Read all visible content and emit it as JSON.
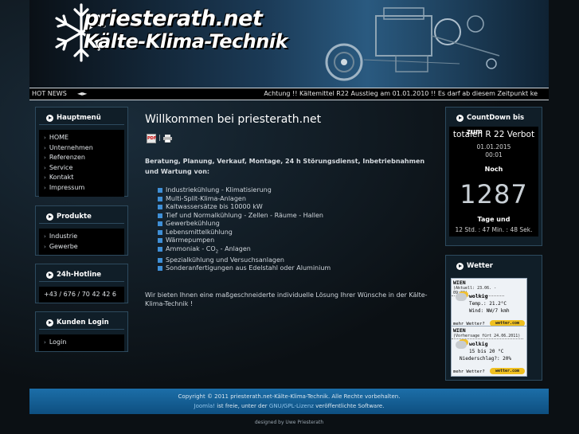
{
  "header": {
    "logo_line1": "priesterath.net",
    "logo_line2": "Kälte-Klima-Technik"
  },
  "hotnews": {
    "label": "HOT NEWS",
    "arrows": "◄►",
    "ticker": "Achtung !! Kältemittel R22 Ausstieg am 01.01.2010 !! Es darf ab diesem Zeitpunkt ke"
  },
  "hauptmenu": {
    "title": "Hauptmenü",
    "items": [
      "HOME",
      "Unternehmen",
      "Referenzen",
      "Service",
      "Kontakt",
      "Impressum"
    ]
  },
  "produkte": {
    "title": "Produkte",
    "items": [
      "Industrie",
      "Gewerbe"
    ]
  },
  "hotline": {
    "title": "24h-Hotline",
    "number": "+43 / 676 / 70 42 42 6"
  },
  "login": {
    "title": "Kunden Login",
    "item": "Login"
  },
  "content": {
    "title": "Willkommen bei priesterath.net",
    "pdf_label": "PDF",
    "separator": "|",
    "lead": "Beratung, Planung, Verkauf, Montage, 24 h Störungsdienst, Inbetriebnahmen und Wartung von:",
    "services": [
      "Industriekühlung - Klimatisierung",
      "Multi-Split-Klima-Anlagen",
      "Kaltwassersätze bis 10000 kW",
      "Tief und Normalkühlung - Zellen - Räume - Hallen",
      "Gewerbekühlung",
      "Lebensmittelkühlung",
      "Wärmepumpen"
    ],
    "service_co2_pre": "Ammoniak - CO",
    "service_co2_sub": "2",
    "service_co2_post": " - Anlagen",
    "services2": [
      "Spezialkühlung und Versuchsanlagen",
      "Sonderanfertigungen aus Edelstahl oder Aluminium"
    ],
    "closing": "Wir bieten Ihnen eine maßgeschneiderte individuelle Lösung Ihrer Wünsche in der Kälte-Klima-Technik !"
  },
  "countdown": {
    "title": "CountDown bis zum",
    "event": "totalen R 22 Verbot",
    "date": "01.01.2015",
    "time": "00:01",
    "noch": "Noch",
    "days": "1287",
    "tage": "Tage und",
    "rest": "12 Std. : 47 Min. : 48 Sek."
  },
  "wetter": {
    "title": "Wetter",
    "cards": [
      {
        "city": "WIEN",
        "sub": "(Aktuell: 23.06. - 09:00)",
        "condition": "wolkig",
        "line1": "Temp.: 21.2°C",
        "line2": "Wind: NW/7 kmh",
        "more": "mehr Wetter?",
        "badge": "wetter.com"
      },
      {
        "city": "WIEN",
        "sub": "(Vorhersage fürt 24.06.2011)",
        "condition": "wolkig",
        "line1": "15 bis 20 °C",
        "line2": "Niederschlag?: 20%",
        "more": "mehr Wetter?",
        "badge": "wetter.com"
      }
    ]
  },
  "footer": {
    "copyright": "Copyright © 2011 priesterath.net-Kälte-Klima-Technik. Alle Rechte vorbehalten.",
    "joomla_link": "Joomla!",
    "text_mid": " ist freie, unter der ",
    "license_link": "GNU/GPL-Lizenz",
    "text_end": " veröffentlichte Software.",
    "designed": "designed by Uwe Priesterath"
  },
  "colors": {
    "accent": "#3f8fd6",
    "footer_bg": "#1c6ea8",
    "box_bg": "#101e28"
  }
}
